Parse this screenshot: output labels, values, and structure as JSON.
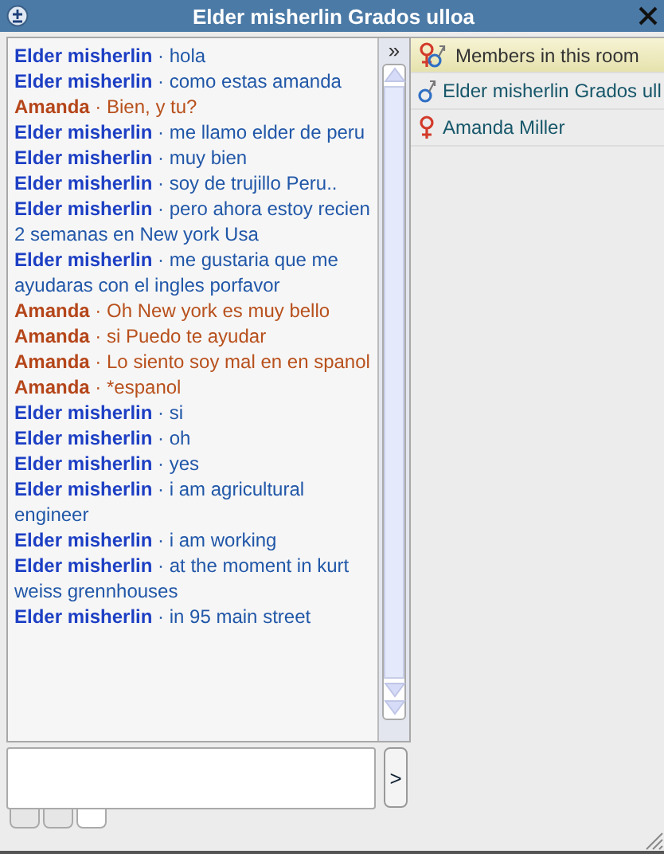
{
  "window": {
    "title": "Elder misherlin Grados ulloa"
  },
  "messages": [
    {
      "speaker": "Elder misherlin",
      "text": "· hola",
      "kind": "male"
    },
    {
      "speaker": "Elder misherlin",
      "text": "· como estas amanda",
      "kind": "male"
    },
    {
      "speaker": "Amanda",
      "text": "· Bien, y tu?",
      "kind": "female"
    },
    {
      "speaker": "Elder misherlin",
      "text": "· me llamo elder de peru",
      "kind": "male"
    },
    {
      "speaker": "Elder misherlin",
      "text": "· muy bien",
      "kind": "male"
    },
    {
      "speaker": "Elder misherlin",
      "text": "· soy de trujillo Peru..",
      "kind": "male"
    },
    {
      "speaker": "Elder misherlin",
      "text": "· pero ahora estoy recien 2 semanas en New york Usa",
      "kind": "male"
    },
    {
      "speaker": "Elder misherlin",
      "text": "· me gustaria que me ayudaras con el ingles porfavor",
      "kind": "male"
    },
    {
      "speaker": "Amanda",
      "text": "· Oh New york es muy bello",
      "kind": "female"
    },
    {
      "speaker": "Amanda",
      "text": "· si Puedo te ayudar",
      "kind": "female"
    },
    {
      "speaker": "Amanda",
      "text": "· Lo siento soy mal en en spanol",
      "kind": "female"
    },
    {
      "speaker": "Amanda",
      "text": "· *espanol",
      "kind": "female"
    },
    {
      "speaker": "Elder misherlin",
      "text": "· si",
      "kind": "male"
    },
    {
      "speaker": "Elder misherlin",
      "text": "· oh",
      "kind": "male"
    },
    {
      "speaker": "Elder misherlin",
      "text": "· yes",
      "kind": "male"
    },
    {
      "speaker": "Elder misherlin",
      "text": "· i am agricultural engineer",
      "kind": "male"
    },
    {
      "speaker": "Elder misherlin",
      "text": "· i am working",
      "kind": "male"
    },
    {
      "speaker": "Elder misherlin",
      "text": "· at the moment in kurt weiss grennhouses",
      "kind": "male"
    },
    {
      "speaker": "Elder misherlin",
      "text": "· in 95 main street",
      "kind": "male"
    }
  ],
  "collapse_button": "»",
  "members": [
    {
      "name": "Members in this room",
      "kind": "header"
    },
    {
      "name": "Elder misherlin Grados ull",
      "kind": "male"
    },
    {
      "name": "Amanda Miller",
      "kind": "female"
    }
  ],
  "send_button": ">",
  "tabs": [
    {
      "selected": false
    },
    {
      "selected": false
    },
    {
      "selected": true
    }
  ]
}
